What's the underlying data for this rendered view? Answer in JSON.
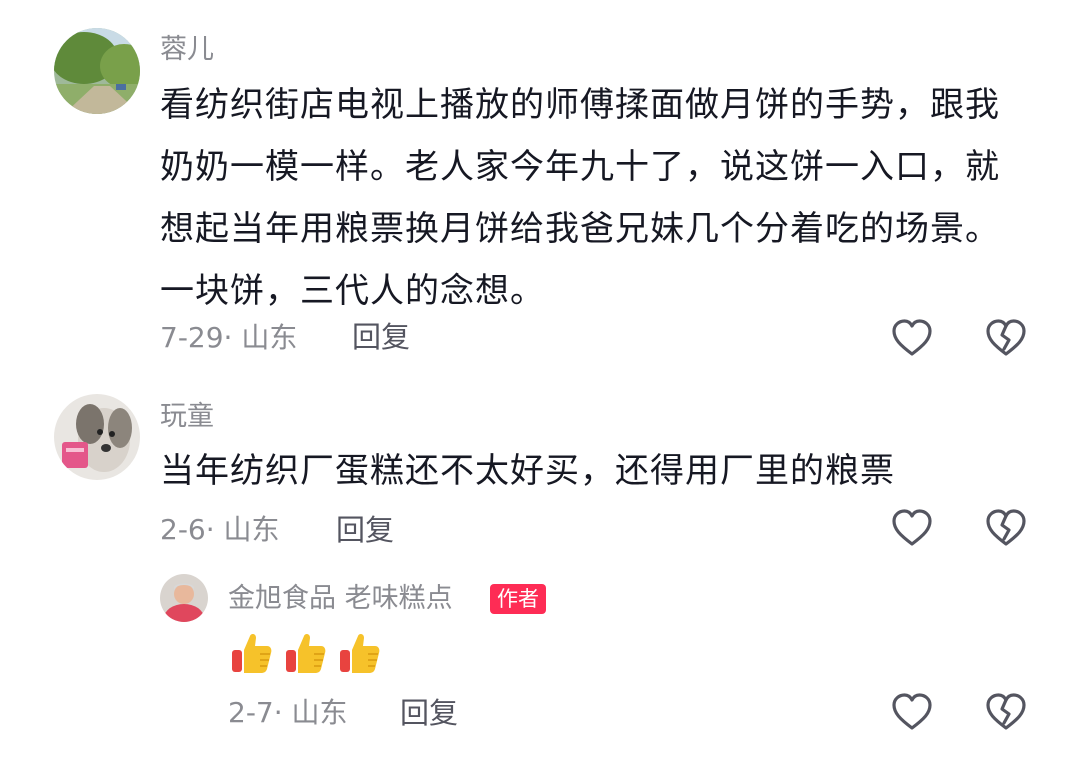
{
  "comments": [
    {
      "username": "蓉儿",
      "text": "看纺织街店电视上播放的师傅揉面做月饼的手势，跟我奶奶一模一样。老人家今年九十了，说这饼一入口，就想起当年用粮票换月饼给我爸兄妹几个分着吃的场景。一块饼，三代人的念想。",
      "meta": "7-29· 山东",
      "reply_label": "回复",
      "avatar_icon": "landscape-photo-avatar",
      "like_icon": "heart-outline-icon",
      "dislike_icon": "broken-heart-icon"
    },
    {
      "username": "玩童",
      "text": "当年纺织厂蛋糕还不太好买，还得用厂里的粮票",
      "meta": "2-6· 山东",
      "reply_label": "回复",
      "avatar_icon": "dog-photo-avatar",
      "like_icon": "heart-outline-icon",
      "dislike_icon": "broken-heart-icon",
      "replies": [
        {
          "username": "金旭食品 老味糕点",
          "badge": "作者",
          "emoji": [
            "👍",
            "👍",
            "👍"
          ],
          "meta": "2-7· 山东",
          "reply_label": "回复",
          "avatar_icon": "person-photo-avatar",
          "like_icon": "heart-outline-icon",
          "dislike_icon": "broken-heart-icon"
        }
      ]
    }
  ],
  "colors": {
    "username": "#8a8b91",
    "body_text": "#161823",
    "reply": "#545560",
    "badge": "#fe2c55",
    "icon_stroke": "#545560"
  }
}
